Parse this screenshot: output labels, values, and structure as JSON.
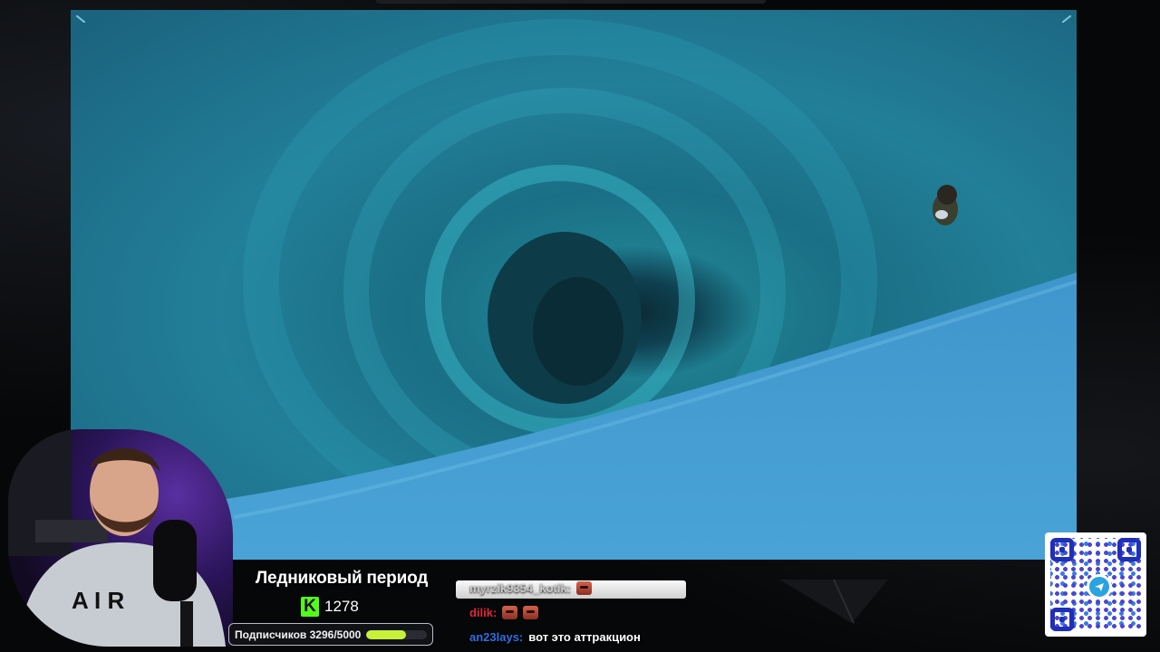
{
  "stream": {
    "game_title": "Ледниковый период",
    "kick_count": "1278",
    "subscribers_label": "Подписчиков 3296/5000",
    "subscribers_progress": 0.659
  },
  "chat": {
    "messages": [
      {
        "user": "myrzik9354_kotik:",
        "user_color": "#c9c9c9",
        "text": "",
        "emotes": 1
      },
      {
        "user": "dilik:",
        "user_color": "#e0283a",
        "text": "",
        "emotes": 2
      },
      {
        "user": "an23lays:",
        "user_color": "#2f6fe4",
        "text": "вот это аттракцион",
        "emotes": 0
      }
    ]
  },
  "icons": {
    "kick": "kick-logo-icon",
    "telegram": "telegram-icon"
  },
  "colors": {
    "kick_green": "#53fc18",
    "progress": "#c8f23a",
    "qr_blue": "#1f2fb8"
  }
}
